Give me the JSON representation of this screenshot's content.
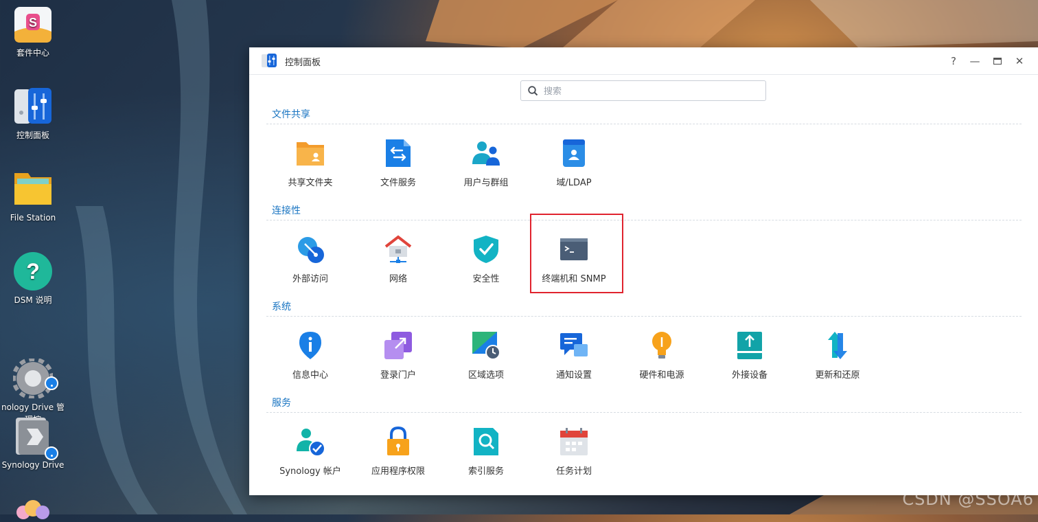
{
  "desktop": {
    "icons": [
      {
        "label": "套件中心",
        "icon": "package-center-icon"
      },
      {
        "label": "控制面板",
        "icon": "control-panel-icon"
      },
      {
        "label": "File Station",
        "icon": "folder-icon"
      },
      {
        "label": "DSM 说明",
        "icon": "help-icon"
      },
      {
        "label": "nology Drive 管理控\n制台",
        "icon": "drive-admin-icon"
      },
      {
        "label": "Synology Drive",
        "icon": "drive-icon"
      }
    ]
  },
  "window": {
    "title": "控制面板",
    "controls": {
      "help": "?",
      "minimize": "—",
      "maximize": "▭",
      "close": "✕"
    },
    "search": {
      "placeholder": "搜索",
      "value": ""
    },
    "sections": [
      {
        "title": "文件共享",
        "items": [
          {
            "label": "共享文件夹",
            "icon": "shared-folder-icon"
          },
          {
            "label": "文件服务",
            "icon": "file-services-icon"
          },
          {
            "label": "用户与群组",
            "icon": "users-groups-icon"
          },
          {
            "label": "域/LDAP",
            "icon": "domain-ldap-icon"
          }
        ]
      },
      {
        "title": "连接性",
        "items": [
          {
            "label": "外部访问",
            "icon": "external-access-icon"
          },
          {
            "label": "网络",
            "icon": "network-icon"
          },
          {
            "label": "安全性",
            "icon": "security-shield-icon"
          },
          {
            "label": "终端机和 SNMP",
            "icon": "terminal-icon"
          }
        ]
      },
      {
        "title": "系统",
        "items": [
          {
            "label": "信息中心",
            "icon": "info-center-icon"
          },
          {
            "label": "登录门户",
            "icon": "login-portal-icon"
          },
          {
            "label": "区域选项",
            "icon": "regional-options-icon"
          },
          {
            "label": "通知设置",
            "icon": "notification-icon"
          },
          {
            "label": "硬件和电源",
            "icon": "hardware-power-icon"
          },
          {
            "label": "外接设备",
            "icon": "external-devices-icon"
          },
          {
            "label": "更新和还原",
            "icon": "update-restore-icon"
          }
        ]
      },
      {
        "title": "服务",
        "items": [
          {
            "label": "Synology 帐户",
            "icon": "synology-account-icon"
          },
          {
            "label": "应用程序权限",
            "icon": "app-privileges-icon"
          },
          {
            "label": "索引服务",
            "icon": "indexing-service-icon"
          },
          {
            "label": "任务计划",
            "icon": "task-scheduler-icon"
          }
        ]
      }
    ]
  },
  "watermark": "CSDN @SSOA6"
}
